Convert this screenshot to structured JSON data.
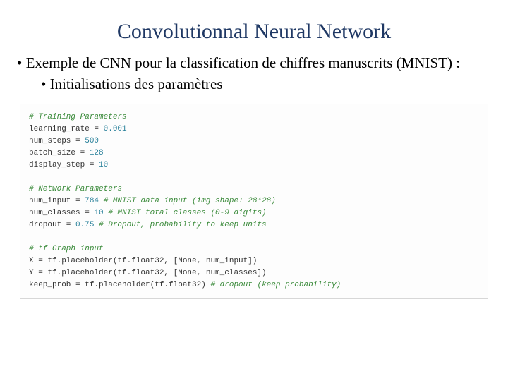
{
  "title": "Convolutionnal Neural Network",
  "bullet1": "• Exemple de CNN pour la classification de chiffres manuscrits (MNIST) :",
  "bullet2": "• Initialisations des paramètres",
  "code": {
    "c1": "# Training Parameters",
    "l1a": "learning_rate = ",
    "l1b": "0.001",
    "l2a": "num_steps = ",
    "l2b": "500",
    "l3a": "batch_size = ",
    "l3b": "128",
    "l4a": "display_step = ",
    "l4b": "10",
    "blank1": " ",
    "c2": "# Network Parameters",
    "l5a": "num_input = ",
    "l5b": "784",
    "l5c": " # MNIST data input (img shape: 28*28)",
    "l6a": "num_classes = ",
    "l6b": "10",
    "l6c": " # MNIST total classes (0-9 digits)",
    "l7a": "dropout = ",
    "l7b": "0.75",
    "l7c": " # Dropout, probability to keep units",
    "blank2": " ",
    "c3": "# tf Graph input",
    "l8": "X = tf.placeholder(tf.float32, [None, num_input])",
    "l9": "Y = tf.placeholder(tf.float32, [None, num_classes])",
    "l10a": "keep_prob = tf.placeholder(tf.float32) ",
    "l10b": "# dropout (keep probability)"
  }
}
